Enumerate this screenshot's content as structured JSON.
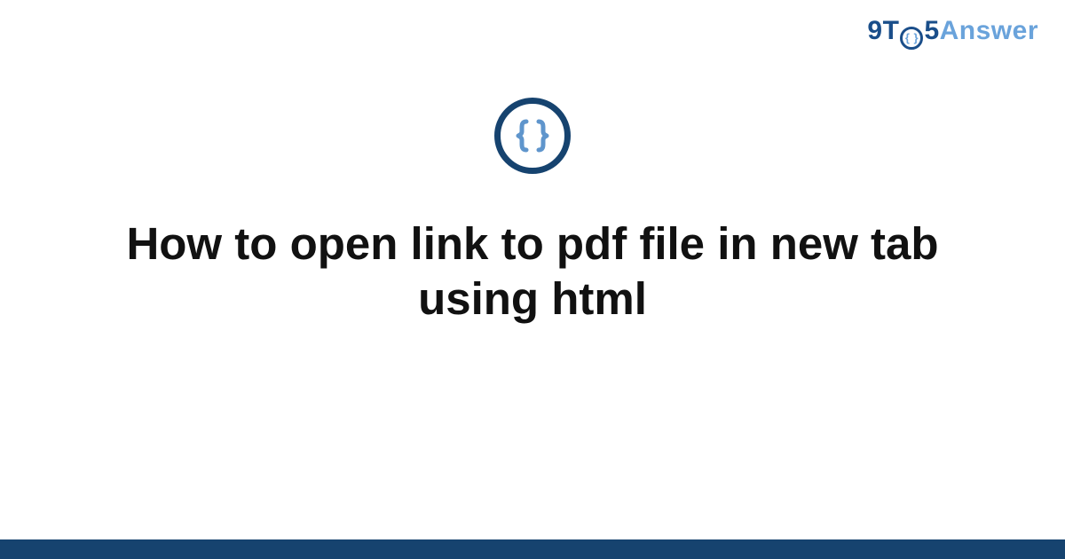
{
  "logo": {
    "part_9": "9",
    "part_T": "T",
    "part_O_inner": "{ }",
    "part_5": "5",
    "part_answer": "Answer"
  },
  "icon": {
    "name": "code-braces-icon"
  },
  "title": "How to open link to pdf file in new tab using html",
  "colors": {
    "brand_dark": "#16436f",
    "brand_light": "#6aa3db"
  }
}
